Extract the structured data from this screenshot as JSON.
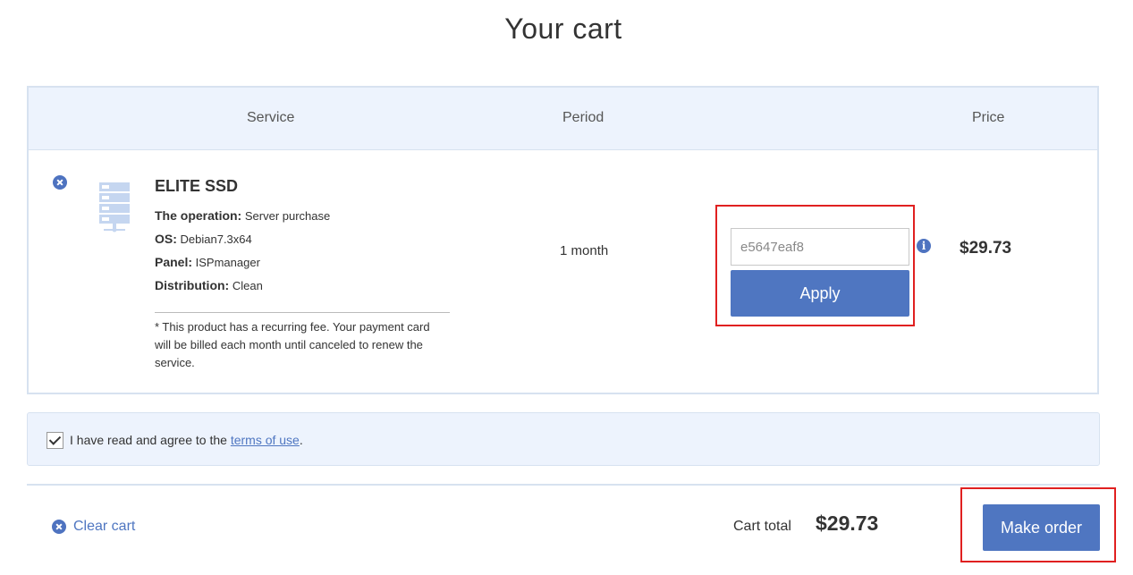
{
  "page": {
    "title": "Your cart"
  },
  "table": {
    "headers": {
      "service": "Service",
      "period": "Period",
      "price": "Price"
    },
    "item": {
      "name": "ELITE SSD",
      "specs": [
        {
          "label": "The operation:",
          "value": "Server purchase"
        },
        {
          "label": "OS:",
          "value": "Debian7.3x64"
        },
        {
          "label": "Panel:",
          "value": "ISPmanager"
        },
        {
          "label": "Distribution:",
          "value": "Clean"
        }
      ],
      "note": "* This product has a recurring fee. Your payment card will be billed each month until canceled to renew the service.",
      "period": "1 month",
      "promo": {
        "value": "e5647eaf8",
        "apply_label": "Apply"
      },
      "price": "$29.73"
    }
  },
  "agreement": {
    "text": "I have read and agree to the",
    "link": "terms of use",
    "suffix": ".",
    "checked": true
  },
  "footer": {
    "clear_label": "Clear cart",
    "total_label": "Cart total",
    "total_value": "$29.73",
    "order_label": "Make order"
  },
  "colors": {
    "accent": "#4f76c1",
    "panel_bg": "#edf3fd",
    "highlight": "#e02020"
  },
  "icons": {
    "remove": "remove-circle-icon",
    "server": "server-icon",
    "info": "info-icon",
    "check": "checkmark-icon"
  }
}
